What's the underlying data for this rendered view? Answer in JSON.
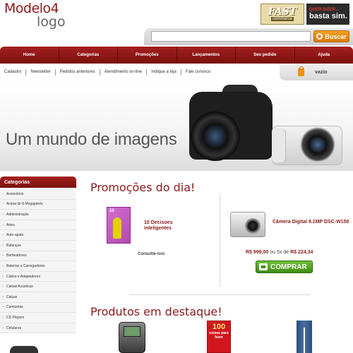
{
  "header": {
    "logo_line1": "Modelo4",
    "logo_line2": "logo",
    "badge_fast_title": "FAST",
    "badge_fast_sub": "commerce",
    "badge_basta_top": "QUER DIZER...",
    "badge_basta_main": "basta sim."
  },
  "search": {
    "placeholder": "",
    "button_label": "Buscar"
  },
  "nav": {
    "items": [
      "Home",
      "Categorias",
      "Promoções",
      "Lançamentos",
      "Seu pedido",
      "Ajuda"
    ]
  },
  "subnav": {
    "links": [
      "Cadastro",
      "Newsletter",
      "Pedidos anteriores",
      "Atendimento on-line",
      "Indique a loja",
      "Fale conosco"
    ],
    "cart_label": "vazio"
  },
  "banner": {
    "text": "Um mundo de imagens"
  },
  "sidebar": {
    "title": "Categorias",
    "items": [
      "Acessórios",
      "Acima de 8 Megapixels",
      "Administração",
      "Artes",
      "Auto-ajuda",
      "Balanças",
      "Barbeadores",
      "Baterias e Carregadores",
      "Cabos e Adaptadores",
      "Caixas Acústicas",
      "Calças",
      "Camisetas",
      "CD Players",
      "Celulares"
    ]
  },
  "promotions": {
    "title": "Promoções do dia!",
    "product1": {
      "book_number": "10",
      "name": "10 Decisoes inteligentes",
      "price": "Consulte-nos"
    },
    "product2": {
      "name": "Câmera Digital 8.1MP DSC-W150",
      "price_full": "R$ 999,00",
      "price_sep": "ou 5x de",
      "price_installment": "R$ 224,34",
      "buy_label": "COMPRAR"
    }
  },
  "featured": {
    "title": "Produtos em destaque!",
    "book2_number": "100",
    "book2_sub": "coisas para fazer"
  },
  "colors": {
    "brand": "#8b1a1a",
    "nav_bg": "#a51f1f",
    "buy_green": "#3e8c13",
    "search_orange": "#f29219"
  }
}
